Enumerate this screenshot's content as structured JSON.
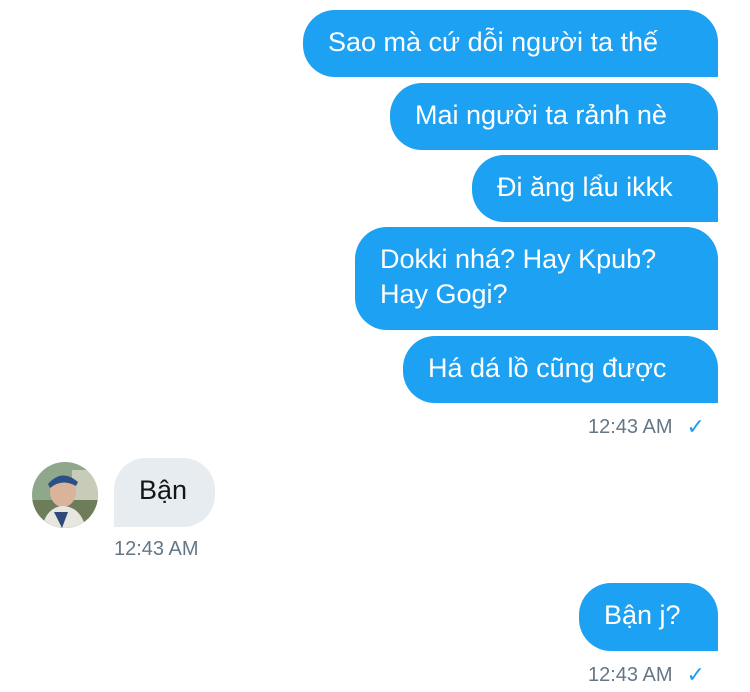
{
  "messages_out_group1": [
    {
      "text": "Sao mà cứ dỗi người ta thế"
    },
    {
      "text": "Mai người ta rảnh nè"
    },
    {
      "text": "Đi ăng lẩu ikkk"
    },
    {
      "text_line1": "Dokki nhá? Hay Kpub?",
      "text_line2": "Hay Gogi?"
    },
    {
      "text": "Há dá lồ cũng được"
    }
  ],
  "group1_meta": {
    "time": "12:43 AM",
    "status": "✓"
  },
  "incoming": {
    "text": "Bận",
    "time": "12:43 AM"
  },
  "messages_out_group2": [
    {
      "text": "Bận j?"
    }
  ],
  "group2_meta": {
    "time": "12:43 AM",
    "status": "✓"
  },
  "colors": {
    "outgoing_bubble": "#1da1f2",
    "incoming_bubble": "#e6ecf0",
    "timestamp": "#657786"
  },
  "icons": {
    "avatar": "user-avatar",
    "delivered": "checkmark-icon"
  }
}
